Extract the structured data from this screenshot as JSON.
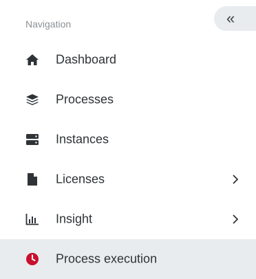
{
  "nav": {
    "title": "Navigation",
    "collapse_glyph": "«",
    "items": [
      {
        "label": "Dashboard",
        "icon": "home-icon",
        "has_submenu": false,
        "active": false
      },
      {
        "label": "Processes",
        "icon": "layers-icon",
        "has_submenu": false,
        "active": false
      },
      {
        "label": "Instances",
        "icon": "server-icon",
        "has_submenu": false,
        "active": false
      },
      {
        "label": "Licenses",
        "icon": "file-icon",
        "has_submenu": true,
        "active": false
      },
      {
        "label": "Insight",
        "icon": "bar-chart-icon",
        "has_submenu": true,
        "active": false
      },
      {
        "label": "Process execution",
        "icon": "clock-icon",
        "has_submenu": false,
        "active": true
      }
    ]
  },
  "colors": {
    "active_bg": "#e9ecef",
    "icon_dark": "#2f3337",
    "clock_red": "#c8102e",
    "muted_text": "#8c9196"
  }
}
